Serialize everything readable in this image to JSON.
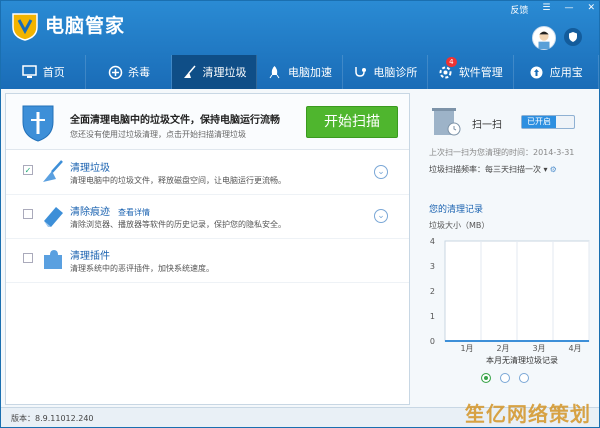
{
  "header": {
    "title": "电脑管家",
    "feedback": "反馈",
    "menu": "☰",
    "minimize": "—",
    "close": "✕"
  },
  "nav": {
    "tabs": [
      {
        "label": "首页",
        "icon": "monitor-icon",
        "active": false
      },
      {
        "label": "杀毒",
        "icon": "antivirus-icon",
        "active": false
      },
      {
        "label": "清理垃圾",
        "icon": "broom-icon",
        "active": true
      },
      {
        "label": "电脑加速",
        "icon": "rocket-icon",
        "active": false
      },
      {
        "label": "电脑诊所",
        "icon": "stethoscope-icon",
        "active": false
      },
      {
        "label": "软件管理",
        "icon": "software-icon",
        "active": false,
        "badge": "4"
      },
      {
        "label": "应用宝",
        "icon": "appstore-icon",
        "active": false
      }
    ]
  },
  "scan": {
    "title": "全面清理电脑中的垃圾文件，保持电脑运行流畅",
    "subtitle": "您还没有使用过垃圾清理，点击开始扫描清理垃圾",
    "button": "开始扫描"
  },
  "items": [
    {
      "title": "清理垃圾",
      "desc": "清理电脑中的垃圾文件，释放磁盘空间，让电脑运行更流畅。",
      "checked": true,
      "link": ""
    },
    {
      "title": "清除痕迹",
      "desc": "清除浏览器、播放器等软件的历史记录，保护您的隐私安全。",
      "checked": false,
      "link": "查看详情"
    },
    {
      "title": "清理插件",
      "desc": "清理系统中的恶评插件，加快系统速度。",
      "checked": false,
      "link": ""
    }
  ],
  "side": {
    "quick_label": "扫一扫",
    "toggle": "已开启",
    "last_clean": "上次扫一扫为您清理的时间：2014-3-31",
    "freq": "垃圾扫描频率：每三天扫描一次 ▾",
    "freq_gear": "⚙",
    "history_title": "您的清理记录",
    "unit_label": "垃圾大小（MB）",
    "caption": "本月无清理垃圾记录"
  },
  "chart_data": {
    "type": "bar",
    "categories": [
      "1月",
      "2月",
      "3月",
      "4月"
    ],
    "values": [
      0,
      0,
      0,
      0
    ],
    "ylim": [
      0,
      4
    ],
    "yticks": [
      0,
      1,
      2,
      3,
      4
    ],
    "ylabel": "垃圾大小（MB）",
    "title": ""
  },
  "status": {
    "version": "版本：8.9.11012.240"
  },
  "watermark": "笙亿网络策划"
}
